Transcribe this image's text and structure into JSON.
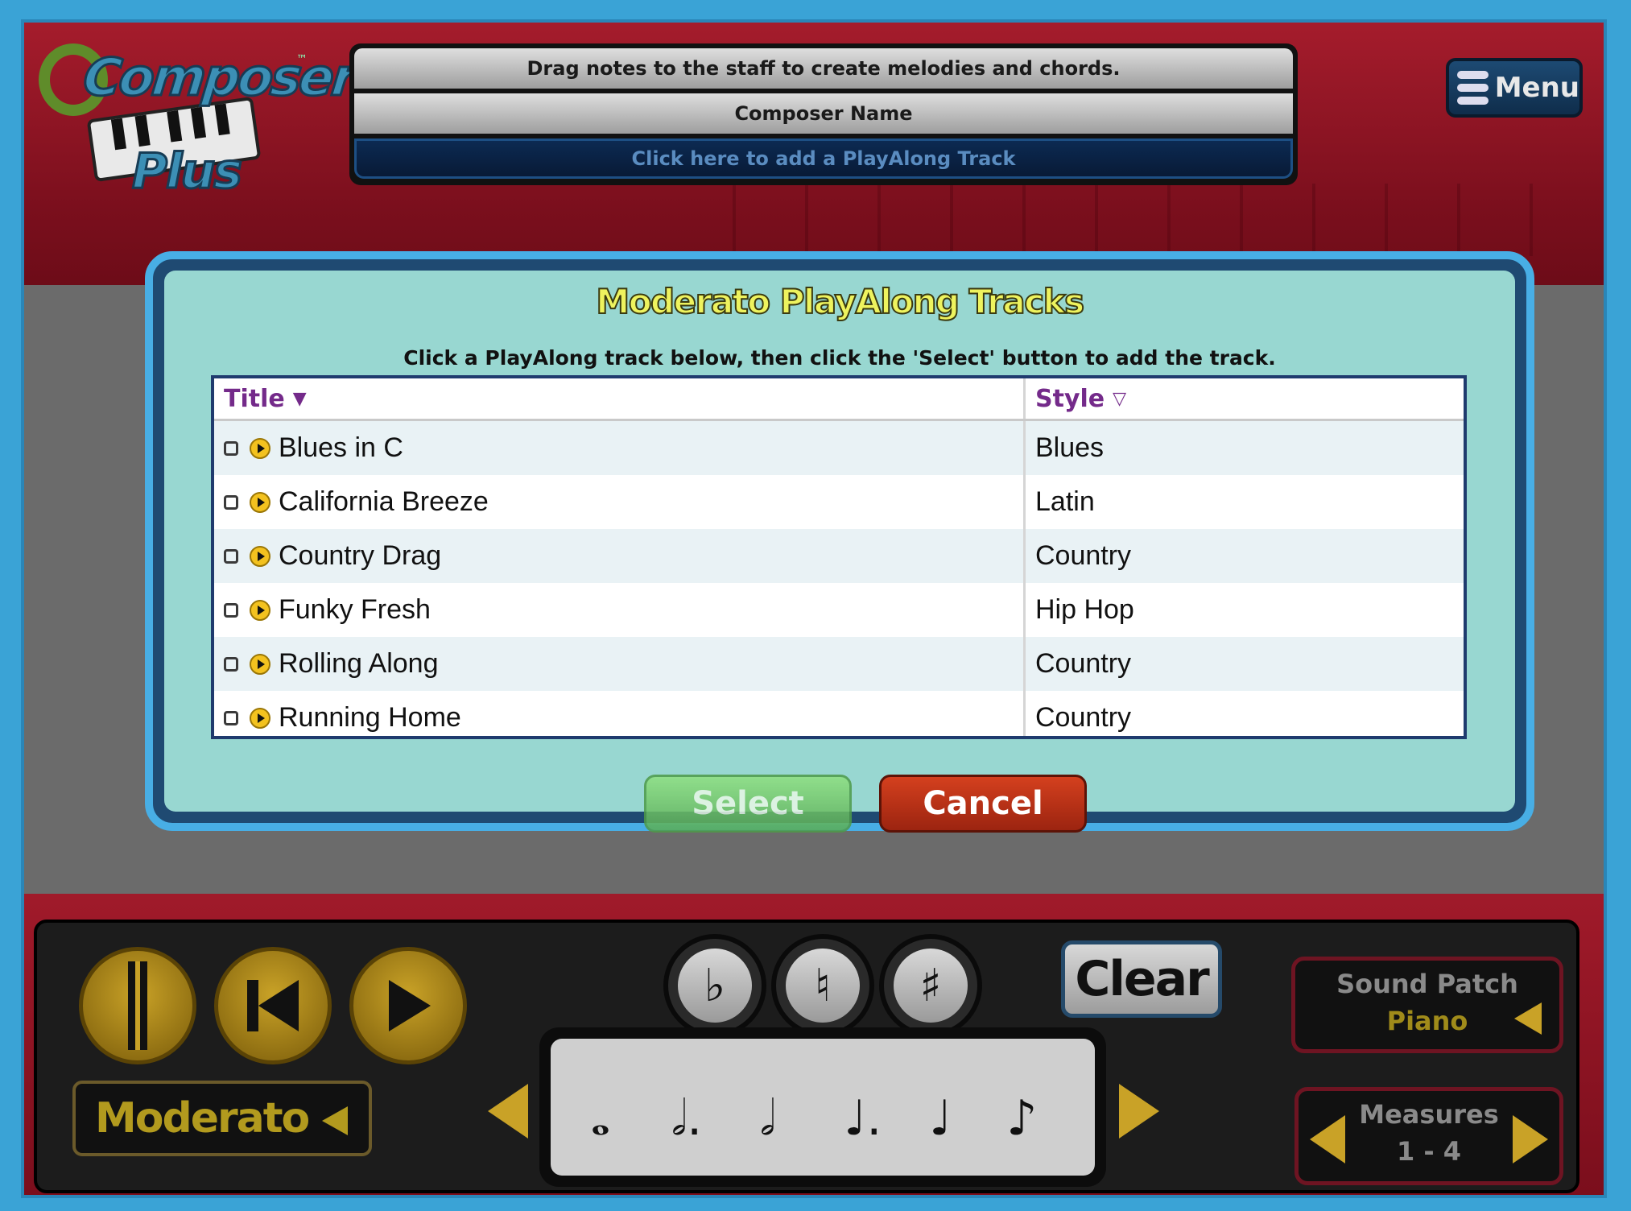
{
  "app": {
    "logo_top": "Composer",
    "logo_bottom": "Plus",
    "tm": "™"
  },
  "header": {
    "instructions": "Drag notes to the staff to create melodies and chords.",
    "composer_name": "Composer Name",
    "playalong_prompt": "Click here to add a PlayAlong Track"
  },
  "menu": {
    "label": "Menu",
    "icon": "hamburger-icon"
  },
  "dialog": {
    "title": "Moderato PlayAlong Tracks",
    "subtitle": "Click a PlayAlong track below, then click the 'Select' button to add the track.",
    "columns": {
      "title": "Title",
      "title_sort": "▼",
      "style": "Style",
      "style_sort": "▽"
    },
    "rows": [
      {
        "title": "Blues in C",
        "style": "Blues"
      },
      {
        "title": "California Breeze",
        "style": "Latin"
      },
      {
        "title": "Country Drag",
        "style": "Country"
      },
      {
        "title": "Funky Fresh",
        "style": "Hip Hop"
      },
      {
        "title": "Rolling Along",
        "style": "Country"
      },
      {
        "title": "Running Home",
        "style": "Country"
      }
    ],
    "select_label": "Select",
    "cancel_label": "Cancel"
  },
  "transport": {
    "icons": [
      "stop-icon",
      "rewind-icon",
      "play-icon"
    ],
    "tempo": "Moderato"
  },
  "accidentals": [
    "♭",
    "♮",
    "♯"
  ],
  "clear_label": "Clear",
  "notes": [
    "𝅝",
    "𝅗𝅥.",
    "𝅗𝅥",
    "♩.",
    "♩",
    "♪"
  ],
  "sound_patch": {
    "label": "Sound Patch",
    "value": "Piano"
  },
  "measures": {
    "label": "Measures",
    "value": "1 - 4"
  },
  "colors": {
    "dialog_bg": "#98d7d1",
    "title_yellow": "#eef35e",
    "header_purple": "#742a8a",
    "select_green": "#6fc466",
    "cancel_red": "#b8321a",
    "gold": "#c9a227"
  }
}
